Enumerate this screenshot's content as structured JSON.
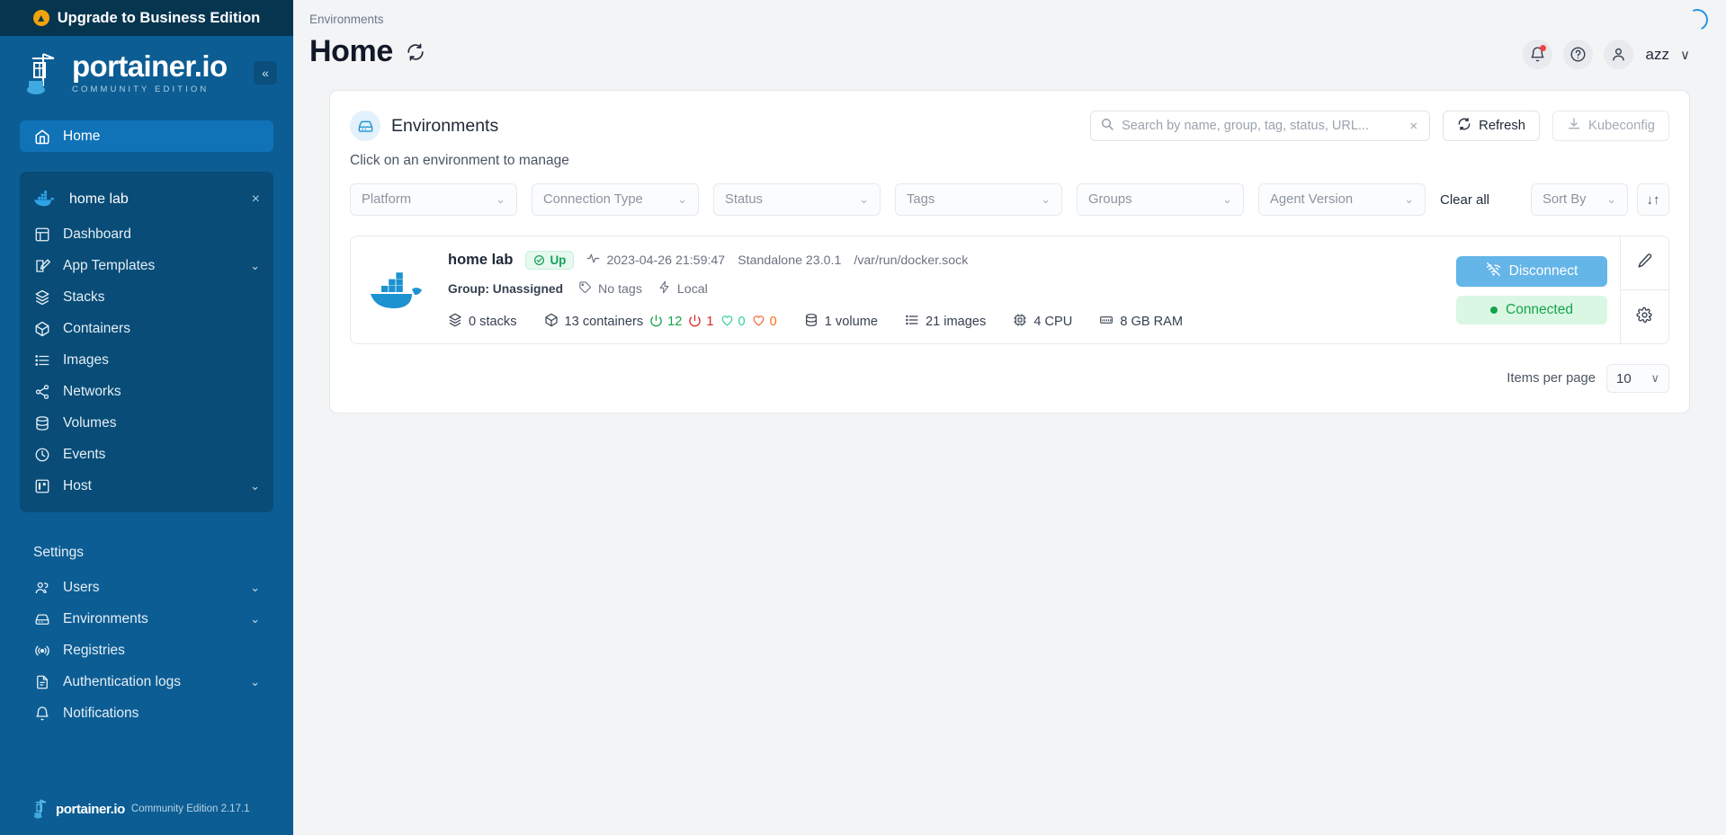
{
  "sidebar": {
    "upgrade_banner": "Upgrade to Business Edition",
    "logo_name": "portainer.io",
    "logo_edition": "COMMUNITY EDITION",
    "collapse_glyph": "«",
    "home_label": "Home",
    "environment": {
      "name": "home lab",
      "close_glyph": "×"
    },
    "env_items": [
      {
        "label": "Dashboard",
        "icon": "dashboard-icon",
        "expandable": false
      },
      {
        "label": "App Templates",
        "icon": "edit-square-icon",
        "expandable": true
      },
      {
        "label": "Stacks",
        "icon": "layers-icon",
        "expandable": false
      },
      {
        "label": "Containers",
        "icon": "box-icon",
        "expandable": false
      },
      {
        "label": "Images",
        "icon": "list-icon",
        "expandable": false
      },
      {
        "label": "Networks",
        "icon": "share-icon",
        "expandable": false
      },
      {
        "label": "Volumes",
        "icon": "database-icon",
        "expandable": false
      },
      {
        "label": "Events",
        "icon": "clock-icon",
        "expandable": false
      },
      {
        "label": "Host",
        "icon": "server-icon",
        "expandable": true
      }
    ],
    "settings_label": "Settings",
    "settings_items": [
      {
        "label": "Users",
        "icon": "users-icon",
        "expandable": true
      },
      {
        "label": "Environments",
        "icon": "hard-drive-icon",
        "expandable": true
      },
      {
        "label": "Registries",
        "icon": "radio-icon",
        "expandable": false
      },
      {
        "label": "Authentication logs",
        "icon": "file-text-icon",
        "expandable": true
      },
      {
        "label": "Notifications",
        "icon": "bell-icon",
        "expandable": false
      }
    ],
    "footer": {
      "name": "portainer.io",
      "version": "Community Edition 2.17.1"
    }
  },
  "header": {
    "breadcrumb": "Environments",
    "title": "Home",
    "refresh_icon": "refresh-icon",
    "user_name": "azz",
    "caret": "∨"
  },
  "panel": {
    "title": "Environments",
    "icon": "hard-drive-icon",
    "note": "Click on an environment to manage",
    "search": {
      "placeholder": "Search by name, group, tag, status, URL...",
      "value": "",
      "clear_glyph": "×"
    },
    "refresh_label": "Refresh",
    "kubeconfig_label": "Kubeconfig"
  },
  "filters": {
    "items": [
      {
        "label": "Platform"
      },
      {
        "label": "Connection Type"
      },
      {
        "label": "Status"
      },
      {
        "label": "Tags"
      },
      {
        "label": "Groups"
      },
      {
        "label": "Agent Version"
      }
    ],
    "clear_all": "Clear all",
    "sort_by": "Sort By",
    "sort_direction_glyph": "↓↑"
  },
  "environments": [
    {
      "name": "home lab",
      "status": "Up",
      "timestamp": "2023-04-26 21:59:47",
      "engine": "Standalone 23.0.1",
      "url": "/var/run/docker.sock",
      "group": "Group: Unassigned",
      "tags": "No tags",
      "location": "Local",
      "stats": {
        "stacks": "0 stacks",
        "containers": "13 containers",
        "running": "12",
        "stopped": "1",
        "healthy": "0",
        "unhealthy": "0",
        "volumes": "1 volume",
        "images": "21 images",
        "cpu": "4 CPU",
        "ram": "8 GB RAM"
      },
      "disconnect_label": "Disconnect",
      "connected_label": "Connected",
      "edit_icon": "pencil-icon",
      "settings_icon": "gear-icon"
    }
  ],
  "pagination": {
    "items_per_page_label": "Items per page",
    "items_per_page_value": "10",
    "caret": "∨"
  },
  "colors": {
    "sidebar_bg": "#0c5d94",
    "sidebar_dark": "#06354f",
    "accent": "#1b8bd6",
    "status_up": "#15a05a",
    "disconnect": "#64b5e8"
  }
}
